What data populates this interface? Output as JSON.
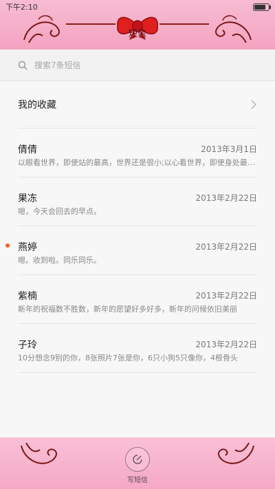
{
  "status": {
    "time": "下午2:10"
  },
  "header": {
    "title": "短信"
  },
  "search": {
    "placeholder": "搜索7条短信"
  },
  "favorites": {
    "label": "我的收藏"
  },
  "messages": [
    {
      "name": "倩倩",
      "date": "2013年3月1日",
      "preview": "以眼看世界，即使站的最高，世界还是很小;以心看世界，即使身处最低，世界也是很大",
      "unread": false
    },
    {
      "name": "果冻",
      "date": "2013年2月22日",
      "preview": "嗯，今天会回去的早点。",
      "unread": false
    },
    {
      "name": "燕婷",
      "date": "2013年2月22日",
      "preview": "嗯。收到啦。同乐同乐。",
      "unread": true
    },
    {
      "name": "紫楠",
      "date": "2013年2月22日",
      "preview": "新年的祝福数不胜数，新年的愿望好多好多，新年的问候依旧美丽",
      "unread": false
    },
    {
      "name": "子玲",
      "date": "2013年2月22日",
      "preview": "10分想念9别的你，8张照片7张是你，6只小狗5只像你，4根骨头",
      "unread": false
    }
  ],
  "footer": {
    "compose_label": "写短信"
  },
  "colors": {
    "unread_dot": "#ff5a1c",
    "header_pink": "#f4a3c0",
    "ribbon": "#e01f1f"
  }
}
